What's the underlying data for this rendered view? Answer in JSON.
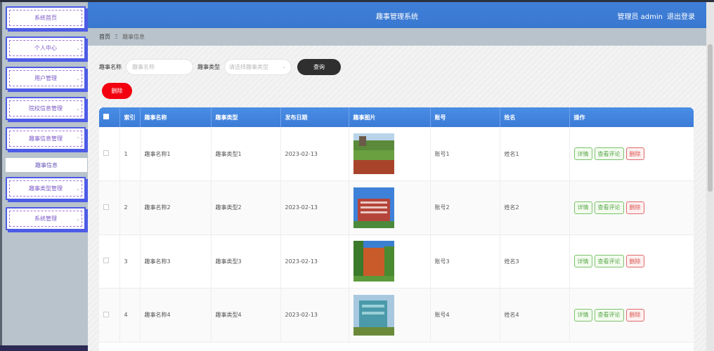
{
  "header": {
    "title": "趣事管理系统",
    "user_label": "管理员 admin",
    "logout": "退出登录"
  },
  "breadcrumb": {
    "home": "首页",
    "sep": "Ξ",
    "current": "趣事信息"
  },
  "sidebar": {
    "items": [
      {
        "label": "系统首页",
        "chevron": false
      },
      {
        "label": "个人中心",
        "chevron": true
      },
      {
        "label": "用户管理",
        "chevron": true
      },
      {
        "label": "院校信息管理",
        "chevron": true
      },
      {
        "label": "趣事信息管理",
        "chevron": true,
        "expanded": true
      },
      {
        "label": "趣事类型管理",
        "chevron": true
      },
      {
        "label": "系统管理",
        "chevron": true
      }
    ],
    "sub_item": "趣事信息"
  },
  "search": {
    "name_label": "趣事名称",
    "name_placeholder": "趣事名称",
    "type_label": "趣事类型",
    "type_placeholder": "请选择趣事类型",
    "query_button": "查询",
    "delete_button": "删除"
  },
  "table": {
    "columns": [
      "",
      "索引",
      "趣事名称",
      "趣事类型",
      "发布日期",
      "趣事图片",
      "账号",
      "姓名",
      "操作"
    ],
    "rows": [
      {
        "index": "1",
        "name": "趣事名称1",
        "type": "趣事类型1",
        "date": "2023-02-13",
        "account": "账号1",
        "person": "姓名1"
      },
      {
        "index": "2",
        "name": "趣事名称2",
        "type": "趣事类型2",
        "date": "2023-02-13",
        "account": "账号2",
        "person": "姓名2"
      },
      {
        "index": "3",
        "name": "趣事名称3",
        "type": "趣事类型3",
        "date": "2023-02-13",
        "account": "账号3",
        "person": "姓名3"
      },
      {
        "index": "4",
        "name": "趣事名称4",
        "type": "趣事类型4",
        "date": "2023-02-13",
        "account": "账号4",
        "person": "姓名4"
      }
    ],
    "actions": {
      "detail": "详情",
      "comment": "查看评论",
      "delete": "删除"
    }
  },
  "colors": {
    "header": "#3f7fd8",
    "sidebar": "#b8c3cb",
    "delete": "#f2000f",
    "query": "#2f2f2f"
  }
}
